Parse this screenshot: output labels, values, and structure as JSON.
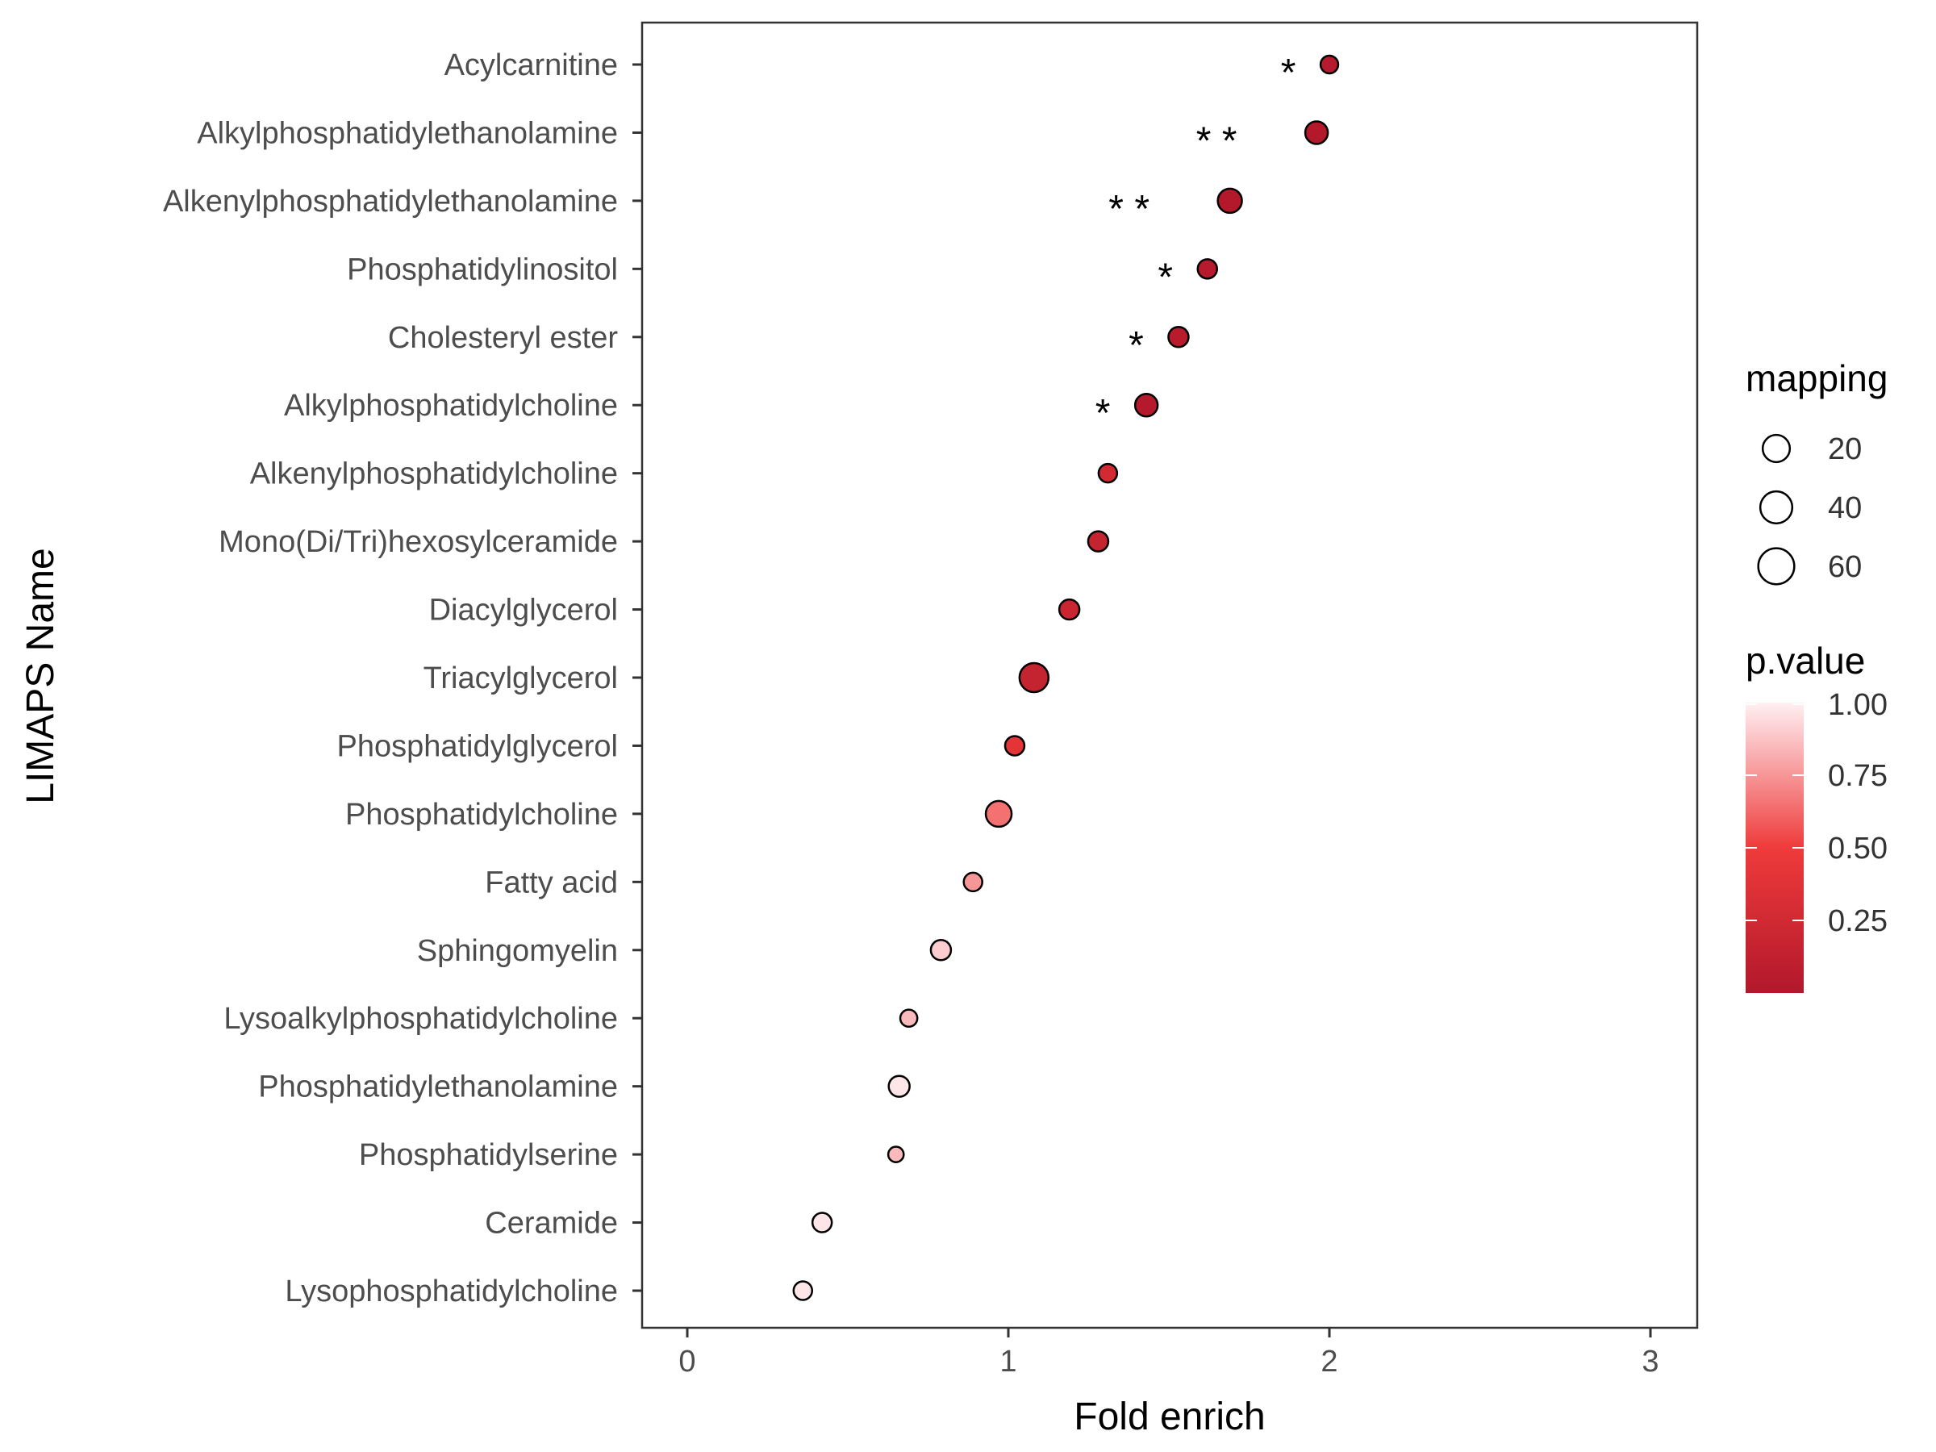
{
  "chart_data": {
    "type": "scatter",
    "xlabel": "Fold enrich",
    "ylabel": "LIMAPS Name",
    "xlim": [
      -0.15,
      3.15
    ],
    "x_ticks": [
      0,
      1,
      2,
      3
    ],
    "grid": false,
    "categories": [
      "Acylcarnitine",
      "Alkylphosphatidylethanolamine",
      "Alkenylphosphatidylethanolamine",
      "Phosphatidylinositol",
      "Cholesteryl ester",
      "Alkylphosphatidylcholine",
      "Alkenylphosphatidylcholine",
      "Mono(Di/Tri)hexosylceramide",
      "Diacylglycerol",
      "Triacylglycerol",
      "Phosphatidylglycerol",
      "Phosphatidylcholine",
      "Fatty acid",
      "Sphingomyelin",
      "Lysoalkylphosphatidylcholine",
      "Phosphatidylethanolamine",
      "Phosphatidylserine",
      "Ceramide",
      "Lysophosphatidylcholine"
    ],
    "fold_enrich": [
      2.0,
      1.96,
      1.69,
      1.62,
      1.53,
      1.43,
      1.31,
      1.28,
      1.19,
      1.08,
      1.02,
      0.97,
      0.89,
      0.79,
      0.69,
      0.66,
      0.65,
      0.42,
      0.36
    ],
    "mapping": [
      15,
      34,
      41,
      21,
      24,
      34,
      18,
      24,
      24,
      66,
      21,
      49,
      18,
      24,
      13,
      27,
      8,
      21,
      18
    ],
    "p_value": [
      0.03,
      0.005,
      0.005,
      0.03,
      0.04,
      0.02,
      0.25,
      0.15,
      0.2,
      0.15,
      0.4,
      0.65,
      0.75,
      0.9,
      0.85,
      0.97,
      0.85,
      0.97,
      0.97
    ],
    "significance": [
      "*",
      "**",
      "**",
      "*",
      "*",
      "*",
      "",
      "",
      "",
      "",
      "",
      "",
      "",
      "",
      "",
      "",
      "",
      "",
      ""
    ],
    "size_legend": {
      "title": "mapping",
      "values": [
        20,
        40,
        60
      ]
    },
    "color_legend": {
      "title": "p.value",
      "ticks": [
        "1.00",
        "0.75",
        "0.50",
        "0.25"
      ],
      "tick_values": [
        1.0,
        0.75,
        0.5,
        0.25
      ],
      "low_color": "#B2182B",
      "mid_color": "#EF3B3B",
      "high_color": "#FFF0F3"
    },
    "legend_placement": "right"
  }
}
